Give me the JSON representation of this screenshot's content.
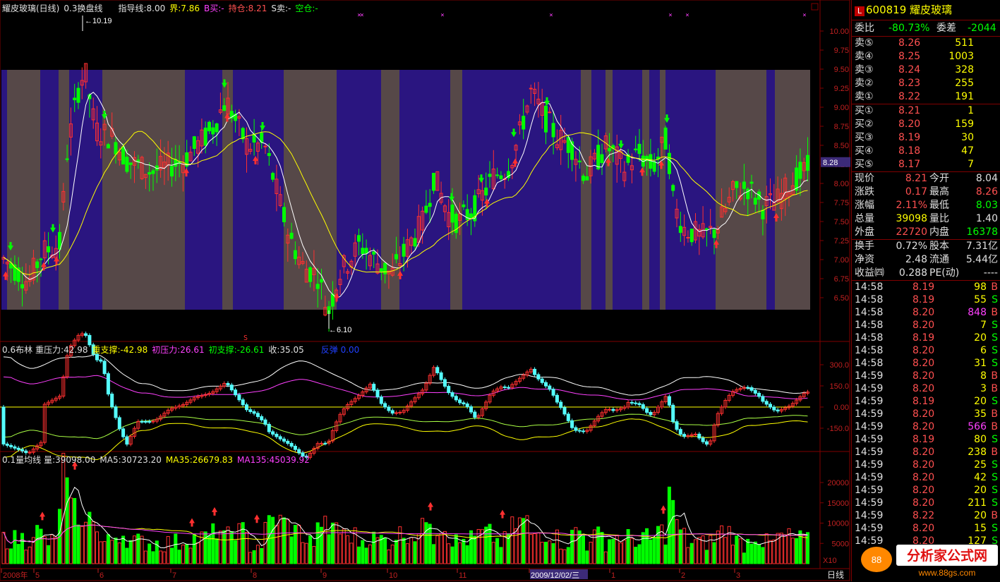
{
  "main_header": {
    "stock_name": "耀皮玻璃(日线)",
    "indicator_name": "0.3换盘线",
    "guide_line": "指导线:8.00",
    "boundary": "界:7.86",
    "b_buy": "B买:-",
    "hold": "持仓:8.21",
    "s_sell": "S卖:-",
    "empty": "空仓:-"
  },
  "price_axis": {
    "ticks": [
      "10.00",
      "9.75",
      "9.50",
      "9.25",
      "9.00",
      "8.75",
      "8.50",
      "8.25",
      "8.00",
      "7.75",
      "7.50",
      "7.25",
      "7.00",
      "6.75",
      "6.50"
    ],
    "current_price_marker": "8.28",
    "high_label": "10.19",
    "low_label": "6.10"
  },
  "boll_header": {
    "name": "0.6布林",
    "heavy_pressure": "重压力:42.98",
    "heavy_support": "重支撑:-42.98",
    "init_pressure": "初压力:26.61",
    "init_support": "初支撑:-26.61",
    "close": "收:35.05",
    "reverse": "反弹 0.00"
  },
  "boll_axis": {
    "ticks": [
      "300.0",
      "150.0",
      "0.00",
      "-150.0"
    ]
  },
  "vol_header": {
    "name": "0.1量均线",
    "volume": "量:39098.00",
    "ma5": "MA5:30723.20",
    "ma35": "MA35:26679.83",
    "ma135": "MA135:45039.92"
  },
  "vol_axis": {
    "ticks": [
      "20000",
      "15000",
      "10000",
      "5000"
    ],
    "unit": "X10"
  },
  "date_axis": {
    "labels": [
      "2008年",
      "5",
      "6",
      "7",
      "8",
      "9",
      "10",
      "11",
      "2009/12/02/三",
      "1",
      "2",
      "3"
    ],
    "period": "日线"
  },
  "quote": {
    "code": "600819",
    "name": "耀皮玻璃",
    "wei_bi_label": "委比",
    "wei_bi": "-80.73%",
    "wei_cha_label": "委差",
    "wei_cha": "-2044",
    "asks": [
      {
        "label": "卖⑤",
        "price": "8.26",
        "vol": "511"
      },
      {
        "label": "卖④",
        "price": "8.25",
        "vol": "1003"
      },
      {
        "label": "卖③",
        "price": "8.24",
        "vol": "328"
      },
      {
        "label": "卖②",
        "price": "8.23",
        "vol": "255"
      },
      {
        "label": "卖①",
        "price": "8.22",
        "vol": "191"
      }
    ],
    "bids": [
      {
        "label": "买①",
        "price": "8.21",
        "vol": "1"
      },
      {
        "label": "买②",
        "price": "8.20",
        "vol": "159"
      },
      {
        "label": "买③",
        "price": "8.19",
        "vol": "30"
      },
      {
        "label": "买④",
        "price": "8.18",
        "vol": "47"
      },
      {
        "label": "买⑤",
        "price": "8.17",
        "vol": "7"
      }
    ],
    "stats": [
      {
        "l1": "现价",
        "v1": "8.21",
        "l2": "今开",
        "v2": "8.04"
      },
      {
        "l1": "涨跌",
        "v1": "0.17",
        "l2": "最高",
        "v2": "8.26"
      },
      {
        "l1": "涨幅",
        "v1": "2.11%",
        "l2": "最低",
        "v2": "8.03"
      },
      {
        "l1": "总量",
        "v1": "39098",
        "l2": "量比",
        "v2": "1.40"
      },
      {
        "l1": "外盘",
        "v1": "22720",
        "l2": "内盘",
        "v2": "16378"
      }
    ],
    "fin": [
      {
        "l1": "换手",
        "v1": "0.72%",
        "l2": "股本",
        "v2": "7.31亿"
      },
      {
        "l1": "净资",
        "v1": "2.48",
        "l2": "流通",
        "v2": "5.44亿"
      },
      {
        "l1": "收益㈣",
        "v1": "0.288",
        "l2": "PE(动)",
        "v2": "----"
      }
    ]
  },
  "ticks": [
    {
      "t": "14:58",
      "p": "8.19",
      "v": "98",
      "d": "B"
    },
    {
      "t": "14:58",
      "p": "8.19",
      "v": "55",
      "d": "S"
    },
    {
      "t": "14:58",
      "p": "8.20",
      "v": "848",
      "d": "B"
    },
    {
      "t": "14:58",
      "p": "8.20",
      "v": "7",
      "d": "S"
    },
    {
      "t": "14:58",
      "p": "8.19",
      "v": "20",
      "d": "S"
    },
    {
      "t": "14:58",
      "p": "8.20",
      "v": "6",
      "d": "S"
    },
    {
      "t": "14:58",
      "p": "8.20",
      "v": "31",
      "d": "S"
    },
    {
      "t": "14:59",
      "p": "8.20",
      "v": "8",
      "d": "B"
    },
    {
      "t": "14:59",
      "p": "8.20",
      "v": "3",
      "d": "B"
    },
    {
      "t": "14:59",
      "p": "8.19",
      "v": "20",
      "d": "S"
    },
    {
      "t": "14:59",
      "p": "8.20",
      "v": "35",
      "d": "B"
    },
    {
      "t": "14:59",
      "p": "8.20",
      "v": "566",
      "d": "B"
    },
    {
      "t": "14:59",
      "p": "8.19",
      "v": "80",
      "d": "S"
    },
    {
      "t": "14:59",
      "p": "8.20",
      "v": "238",
      "d": "B"
    },
    {
      "t": "14:59",
      "p": "8.20",
      "v": "25",
      "d": "S"
    },
    {
      "t": "14:59",
      "p": "8.20",
      "v": "42",
      "d": "S"
    },
    {
      "t": "14:59",
      "p": "8.20",
      "v": "20",
      "d": "S"
    },
    {
      "t": "14:59",
      "p": "8.20",
      "v": "211",
      "d": "S"
    },
    {
      "t": "14:59",
      "p": "8.22",
      "v": "20",
      "d": "B"
    },
    {
      "t": "14:59",
      "p": "8.20",
      "v": "15",
      "d": "S"
    },
    {
      "t": "14:59",
      "p": "8.20",
      "v": "127",
      "d": "S"
    }
  ],
  "watermark": {
    "text": "分析家公式网",
    "url": "www.88gs.com"
  },
  "colors": {
    "up": "#ff3030",
    "down": "#00ff00",
    "band_purple": "#2a1580",
    "band_gray": "#564848",
    "ma_white": "#ffffff",
    "ma_yellow": "#ffff00",
    "magenta": "#ff40ff",
    "cyan": "#55ffff"
  }
}
